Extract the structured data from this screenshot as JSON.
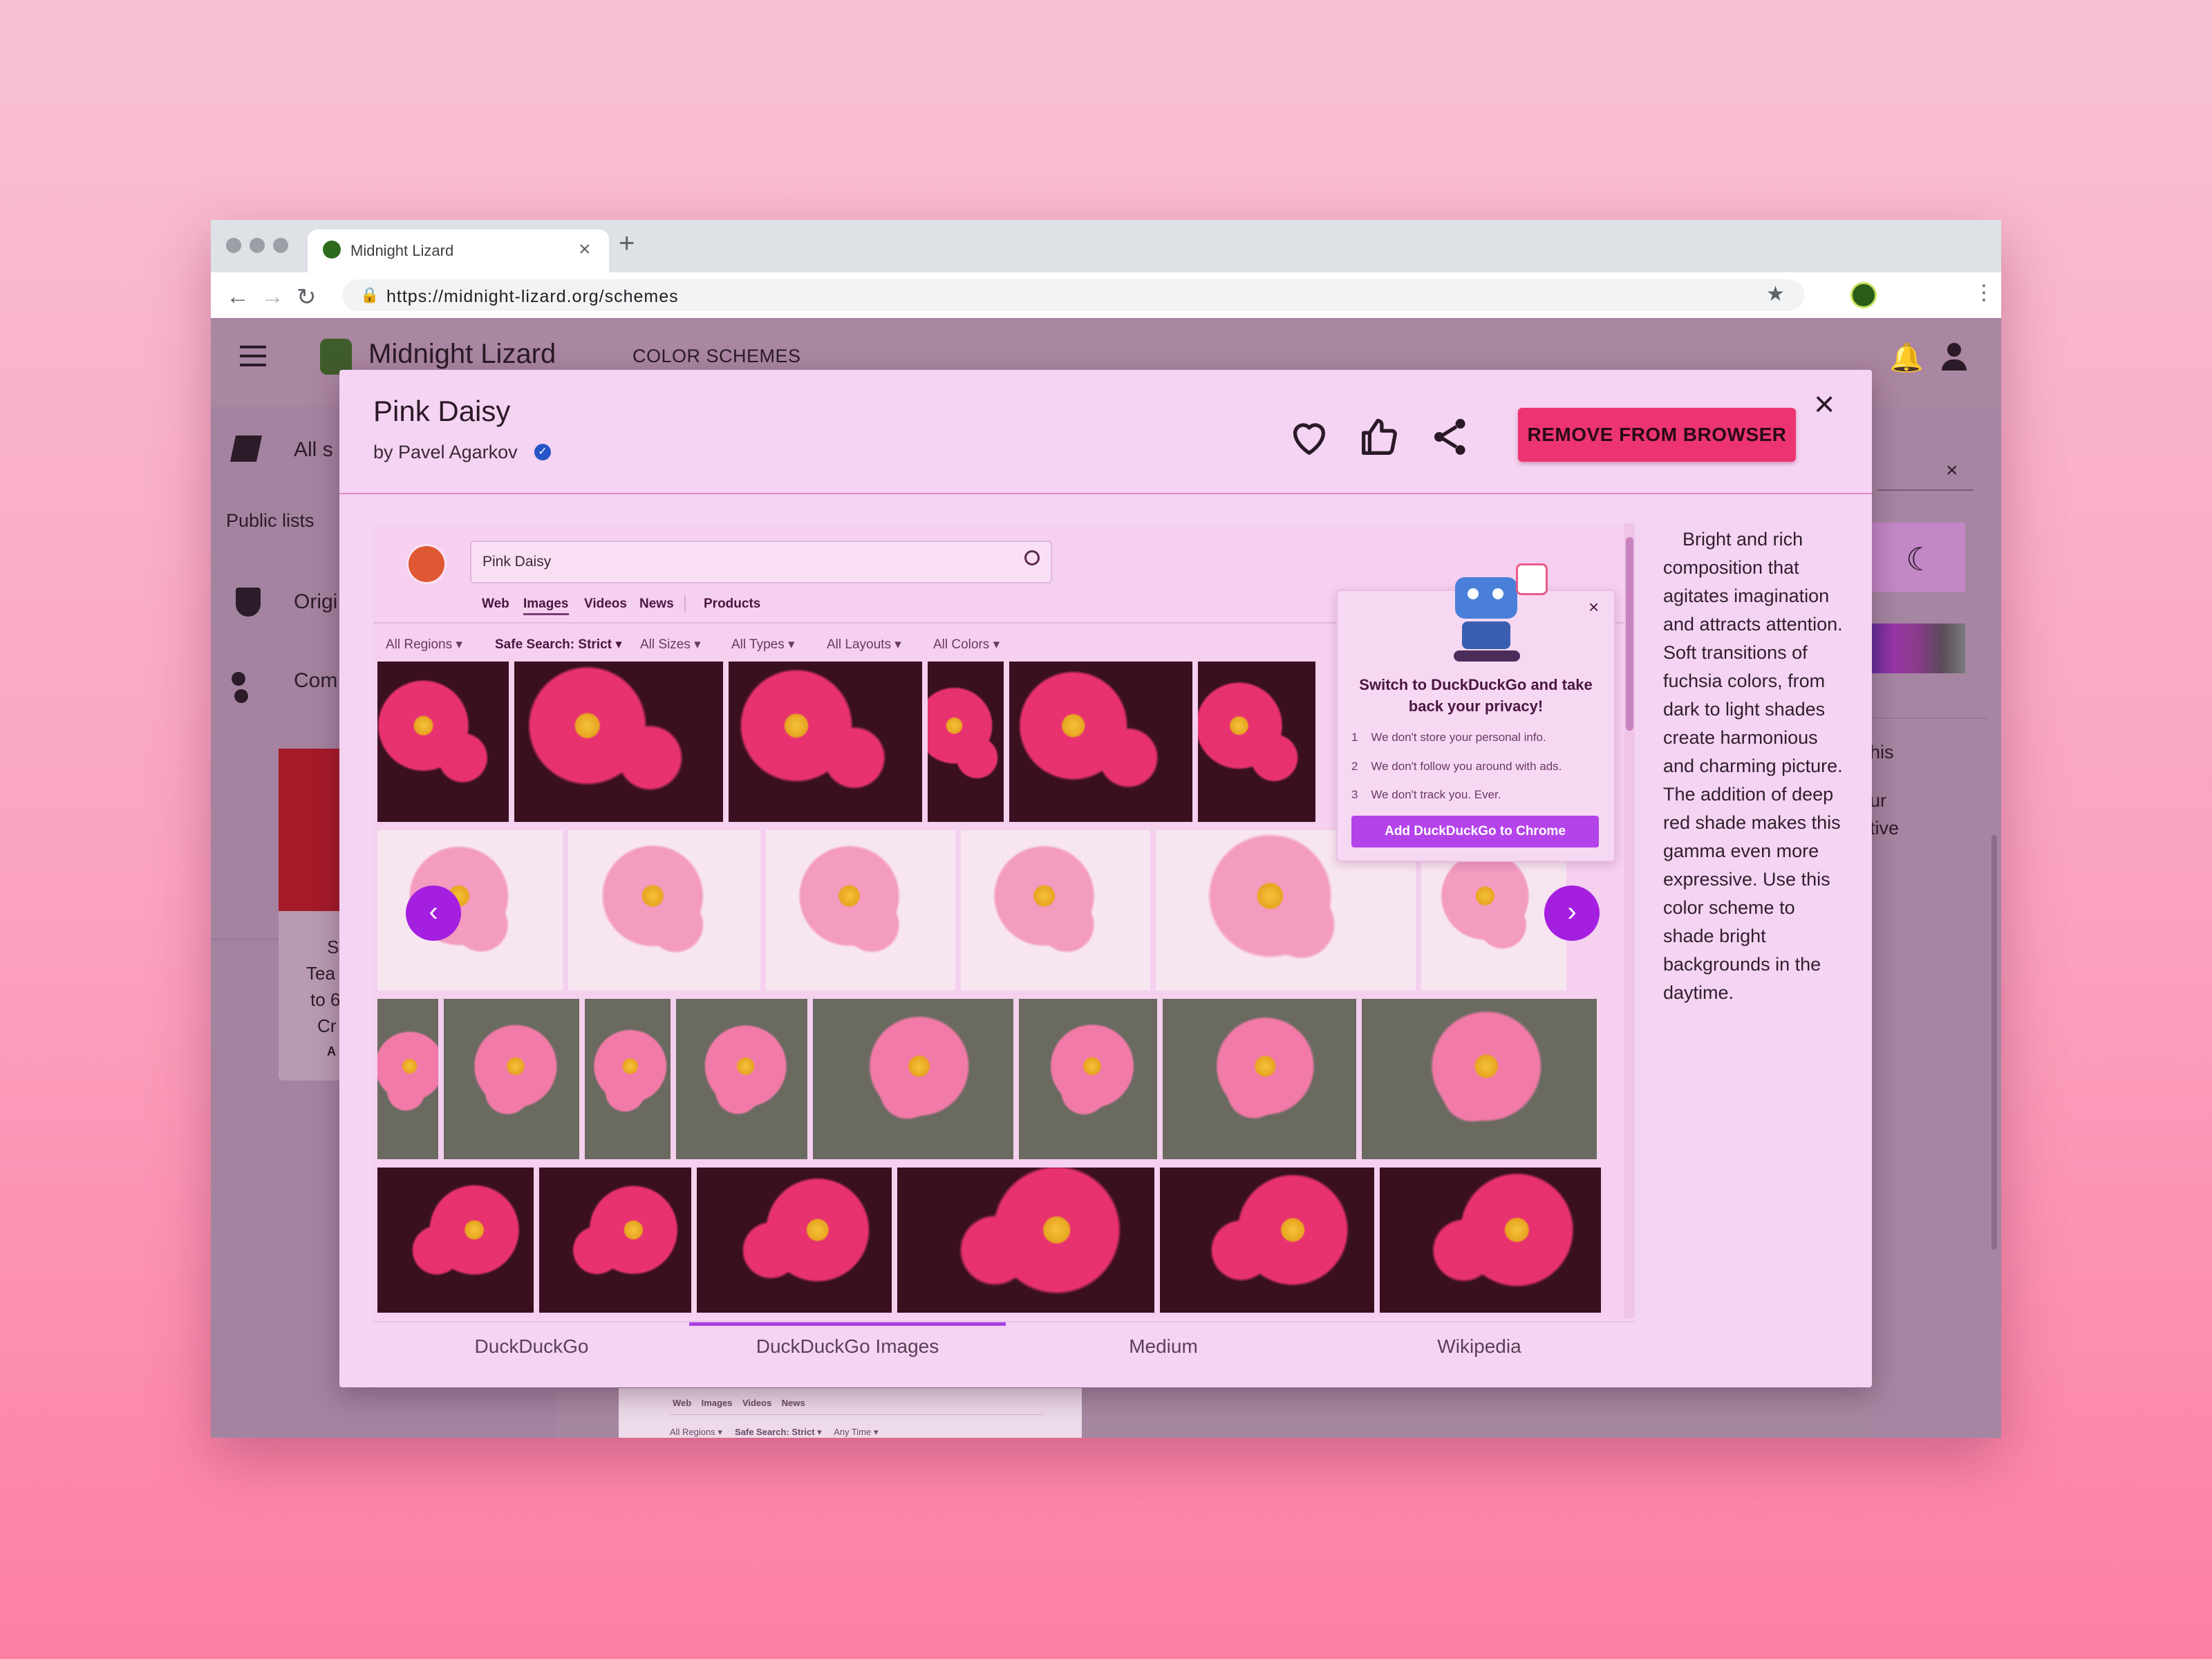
{
  "browser": {
    "tab_title": "Midnight Lizard",
    "url": "https://midnight-lizard.org/schemes"
  },
  "app": {
    "title": "Midnight Lizard",
    "nav_label": "COLOR SCHEMES",
    "sidebar": {
      "all_label": "All s",
      "public_lists": "Public lists",
      "original_label": "Origi",
      "community_label": "Com"
    },
    "card_fragment": [
      "S",
      "Tea",
      "to 6",
      "Cr",
      "A"
    ],
    "right_fragment": [
      "his",
      "ur",
      "tive"
    ]
  },
  "modal": {
    "title": "Pink Daisy",
    "author": "by Pavel Agarkov",
    "remove_label": "REMOVE FROM BROWSER",
    "description": "Bright and rich composition that agitates imagination and attracts attention. Soft transitions of fuchsia colors, from dark to light shades create harmonious and charming picture. The addition of deep red shade makes this gamma even more expressive. Use this color scheme to shade bright backgrounds in the daytime.",
    "site_tabs": [
      "DuckDuckGo",
      "DuckDuckGo Images",
      "Medium",
      "Wikipedia"
    ],
    "active_site_tab": 1
  },
  "preview": {
    "query": "Pink Daisy",
    "tabs": [
      "Web",
      "Images",
      "Videos",
      "News",
      "Products"
    ],
    "active_tab": 1,
    "filters": [
      "All Regions ▾",
      "Safe Search: Strict ▾",
      "All Sizes ▾",
      "All Types ▾",
      "All Layouts ▾",
      "All Colors ▾"
    ],
    "popup": {
      "title": "Switch to DuckDuckGo and take back your privacy!",
      "items": [
        {
          "num": "1",
          "text": "We don't store your personal info."
        },
        {
          "num": "2",
          "text": "We don't follow you around with ads."
        },
        {
          "num": "3",
          "text": "We don't track you. Ever."
        }
      ],
      "button": "Add DuckDuckGo to Chrome"
    },
    "mini_tabs": [
      "Web",
      "Images",
      "Videos",
      "News"
    ],
    "mini_filters": [
      "All Regions ▾",
      "Safe Search: Strict ▾",
      "Any Time ▾"
    ]
  },
  "colors": {
    "accent": "#ec3473",
    "purple": "#a51fe0",
    "modal_bg": "#f5d3f2"
  }
}
